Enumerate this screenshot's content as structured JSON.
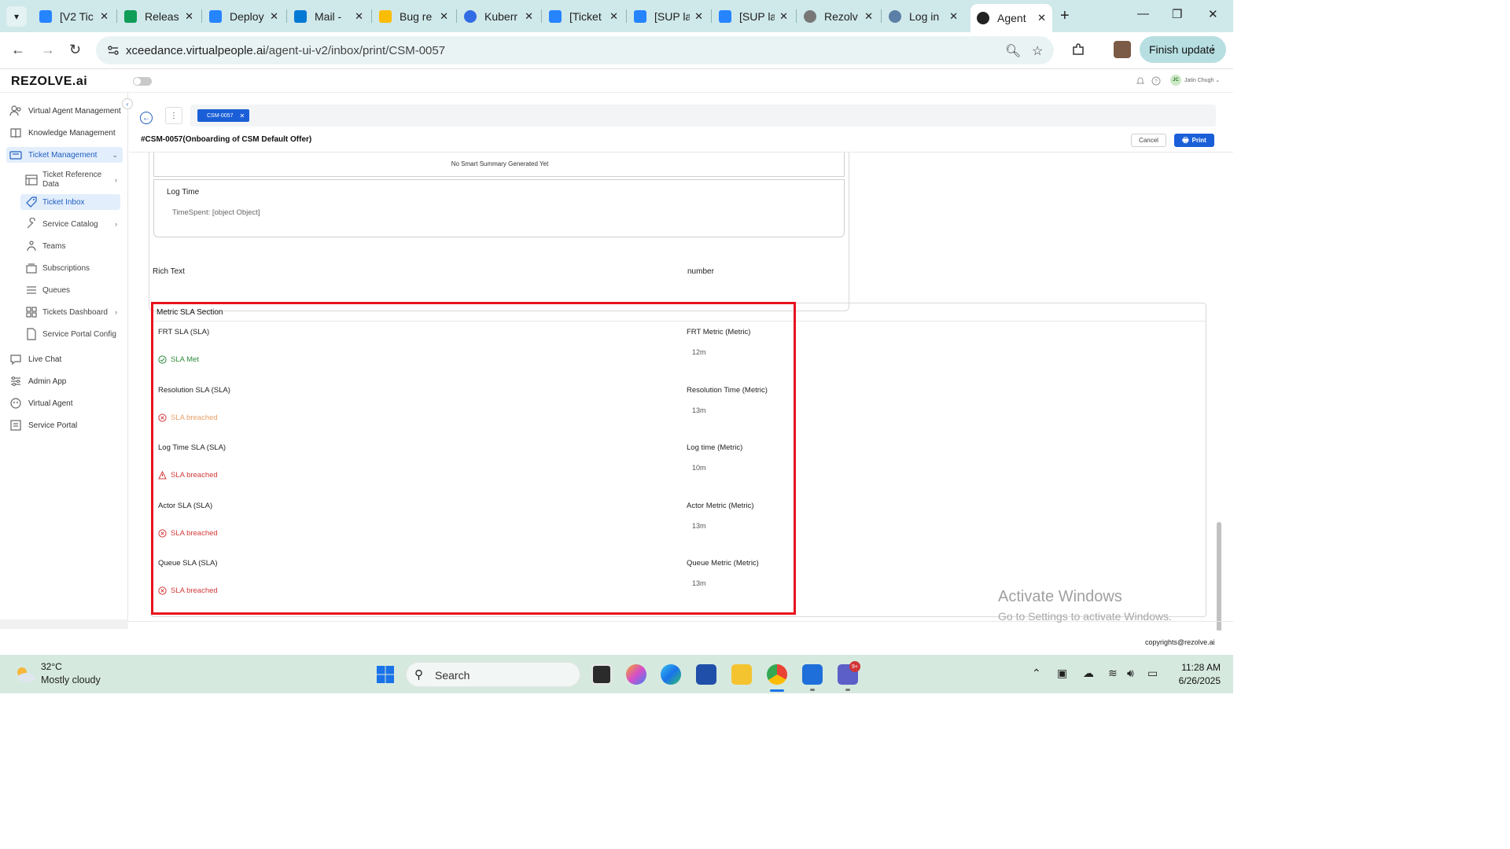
{
  "browser": {
    "tabs": [
      {
        "label": "[V2 Tic",
        "color": "#2684ff"
      },
      {
        "label": "Releas",
        "color": "#0f9d58"
      },
      {
        "label": "Deploy",
        "color": "#2684ff"
      },
      {
        "label": "Mail - ",
        "color": "#0078d4"
      },
      {
        "label": "Bug re",
        "color": "#fbbc04"
      },
      {
        "label": "Kuberr",
        "color": "#326ce5"
      },
      {
        "label": "[Ticket",
        "color": "#2684ff"
      },
      {
        "label": "[SUP la",
        "color": "#2684ff"
      },
      {
        "label": "[SUP la",
        "color": "#2684ff"
      },
      {
        "label": "Rezolv",
        "color": "#777777"
      },
      {
        "label": "Log in",
        "color": "#5b7fa6"
      },
      {
        "label": "Agent",
        "color": "#222222"
      }
    ],
    "url_host": "xceedance.virtualpeople.ai",
    "url_path": "/agent-ui-v2/inbox/print/CSM-0057",
    "finish_update": "Finish update"
  },
  "app": {
    "logo": "REZOLVE.ai",
    "user_initials": "JC",
    "user_name": "Jatin Chugh",
    "sidebar": {
      "items": [
        {
          "label": "Virtual Agent Management"
        },
        {
          "label": "Knowledge Management"
        },
        {
          "label": "Ticket Management"
        },
        {
          "label": "Live Chat"
        },
        {
          "label": "Admin App"
        },
        {
          "label": "Virtual Agent"
        },
        {
          "label": "Service Portal"
        }
      ],
      "subitems": [
        {
          "label": "Ticket Reference Data"
        },
        {
          "label": "Ticket Inbox"
        },
        {
          "label": "Service Catalog"
        },
        {
          "label": "Teams"
        },
        {
          "label": "Subscriptions"
        },
        {
          "label": "Queues"
        },
        {
          "label": "Tickets Dashboard"
        },
        {
          "label": "Service Portal Config"
        }
      ]
    },
    "ticket_chip": "CSM-0057",
    "ticket_title": "#CSM-0057(Onboarding of CSM Default Offer)",
    "cancel": "Cancel",
    "print": "Print",
    "summary": "No Smart Summary Generated Yet",
    "log_time_title": "Log Time",
    "log_time_value": "TimeSpent: [object Object]",
    "rich_text_label": "Rich Text",
    "number_label": "number",
    "sla_section": {
      "title": "Metric SLA Section",
      "rows": [
        {
          "sla": "FRT SLA (SLA)",
          "status": "SLA Met",
          "metric": "FRT Metric (Metric)",
          "value": "12m"
        },
        {
          "sla": "Resolution SLA (SLA)",
          "status": "SLA breached",
          "metric": "Resolution Time (Metric)",
          "value": "13m"
        },
        {
          "sla": "Log Time SLA (SLA)",
          "status": "SLA breached",
          "metric": "Log time (Metric)",
          "value": "10m"
        },
        {
          "sla": "Actor SLA (SLA)",
          "status": "SLA breached",
          "metric": "Actor Metric (Metric)",
          "value": "13m"
        },
        {
          "sla": "Queue SLA (SLA)",
          "status": "SLA breached",
          "metric": "Queue Metric (Metric)",
          "value": "13m"
        }
      ]
    },
    "copyright": "copyrights@rezolve.ai"
  },
  "watermark": {
    "line1": "Activate Windows",
    "line2": "Go to Settings to activate Windows."
  },
  "taskbar": {
    "temperature": "32°C",
    "weather": "Mostly cloudy",
    "search": "Search",
    "badge": "9+",
    "time": "11:28 AM",
    "date": "6/26/2025"
  }
}
